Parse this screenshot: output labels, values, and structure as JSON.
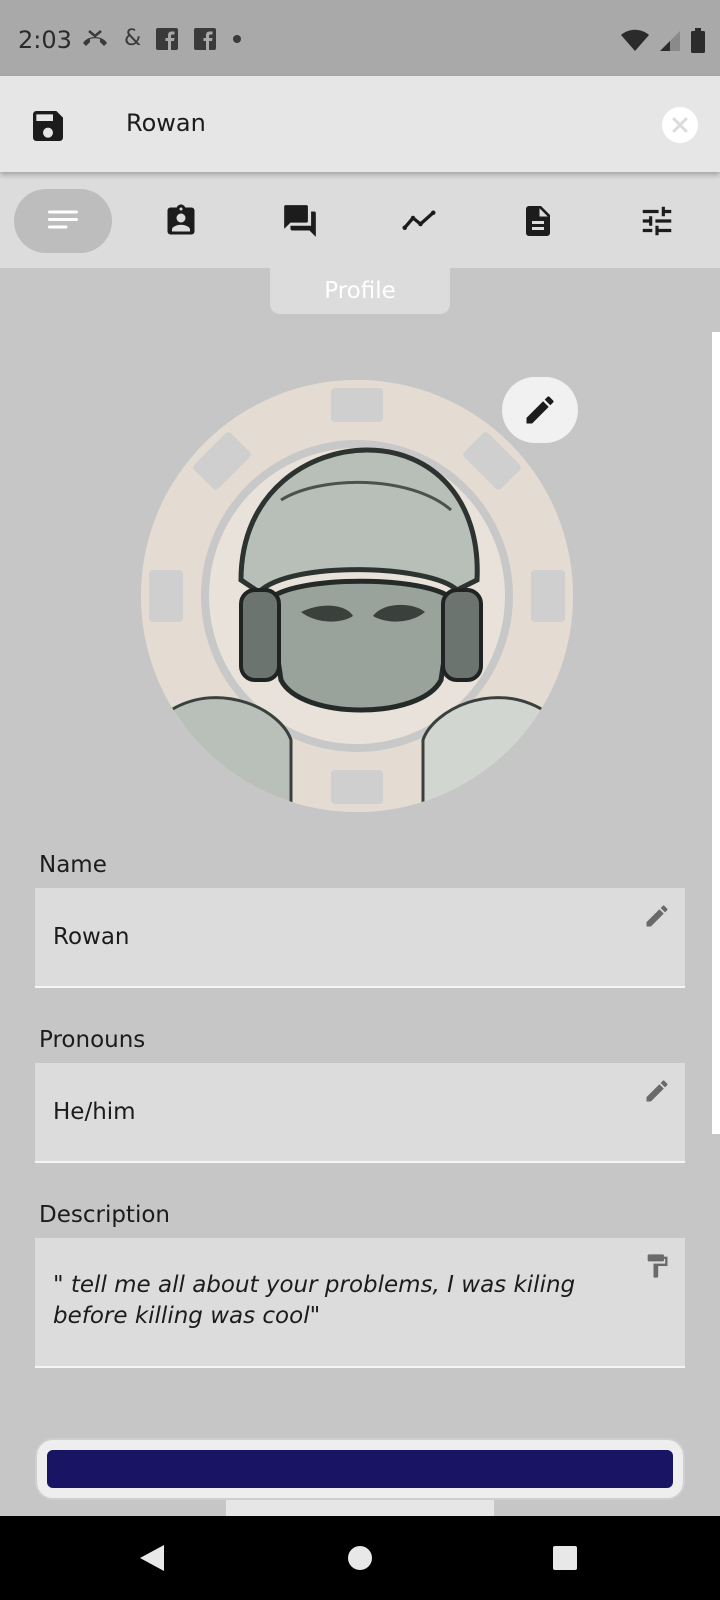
{
  "status_bar": {
    "time": "2:03",
    "ampersand": "&",
    "icons": [
      "missed-call-icon",
      "facebook-icon",
      "facebook-icon",
      "dot-icon",
      "wifi-icon",
      "cell-signal-icon",
      "battery-icon"
    ]
  },
  "top_bar": {
    "title": "Rowan",
    "save_icon": "save-icon",
    "close_icon": "close-icon"
  },
  "tabs": [
    {
      "name": "profile",
      "icon": "notes-icon",
      "active": true
    },
    {
      "name": "id",
      "icon": "id-badge-icon",
      "active": false
    },
    {
      "name": "chat",
      "icon": "chat-icon",
      "active": false
    },
    {
      "name": "stats",
      "icon": "trend-icon",
      "active": false
    },
    {
      "name": "document",
      "icon": "document-icon",
      "active": false
    },
    {
      "name": "settings",
      "icon": "sliders-icon",
      "active": false
    }
  ],
  "active_tab_label": "Profile",
  "fields": {
    "name": {
      "label": "Name",
      "value": "Rowan"
    },
    "pronouns": {
      "label": "Pronouns",
      "value": "He/him"
    },
    "description": {
      "label": "Description",
      "value": "\" tell me all about your problems, I was kiling before killing was cool\""
    }
  },
  "color_bar": {
    "color": "#1a1464"
  },
  "colors": {
    "accent": "#1a1464",
    "background": "#c6c6c6",
    "surface": "#dcdcdc"
  }
}
